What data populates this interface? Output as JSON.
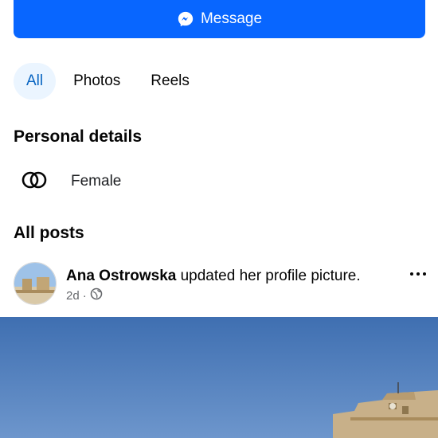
{
  "message_button": {
    "label": "Message",
    "icon": "messenger-icon",
    "color": "#0866ff"
  },
  "tabs": [
    {
      "label": "All",
      "active": true
    },
    {
      "label": "Photos",
      "active": false
    },
    {
      "label": "Reels",
      "active": false
    }
  ],
  "personal_details": {
    "title": "Personal details",
    "items": [
      {
        "icon": "gender-icon",
        "label": "Female"
      }
    ]
  },
  "posts": {
    "title": "All posts",
    "items": [
      {
        "author": "Ana Ostrowska",
        "action": "updated her profile picture.",
        "time": "2d",
        "separator": "·",
        "audience_icon": "globe-icon",
        "more_icon": "more-options-icon"
      }
    ]
  }
}
